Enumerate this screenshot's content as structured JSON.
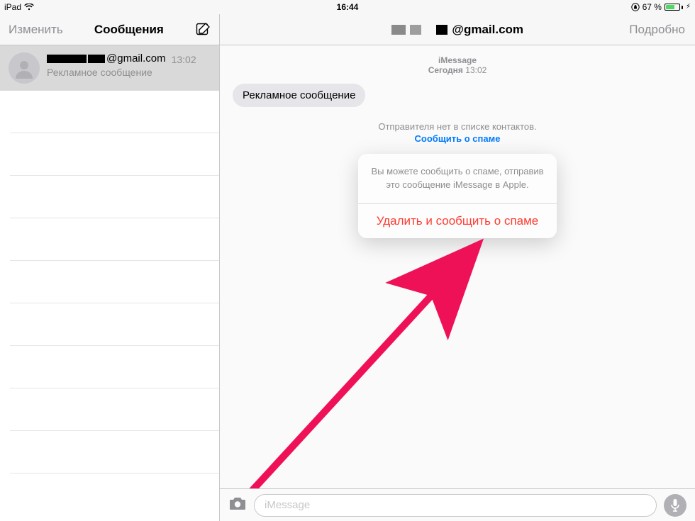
{
  "status": {
    "device": "iPad",
    "time": "16:44",
    "battery_pct": "67 %"
  },
  "sidebar_header": {
    "edit": "Изменить",
    "title": "Сообщения"
  },
  "main_header": {
    "contact_domain": "@gmail.com",
    "details": "Подробно"
  },
  "conversation": {
    "contact_domain": "@gmail.com",
    "time": "13:02",
    "preview": "Рекламное сообщение"
  },
  "thread": {
    "service": "iMessage",
    "day": "Сегодня",
    "time": "13:02",
    "bubble": "Рекламное сообщение",
    "not_in_contacts": "Отправителя нет в списке контактов.",
    "report_spam_link": "Сообщить о спаме"
  },
  "popover": {
    "info": "Вы можете сообщить о спаме, отправив это сообщение iMessage в Apple.",
    "action": "Удалить и сообщить о спаме"
  },
  "compose": {
    "placeholder": "iMessage"
  }
}
